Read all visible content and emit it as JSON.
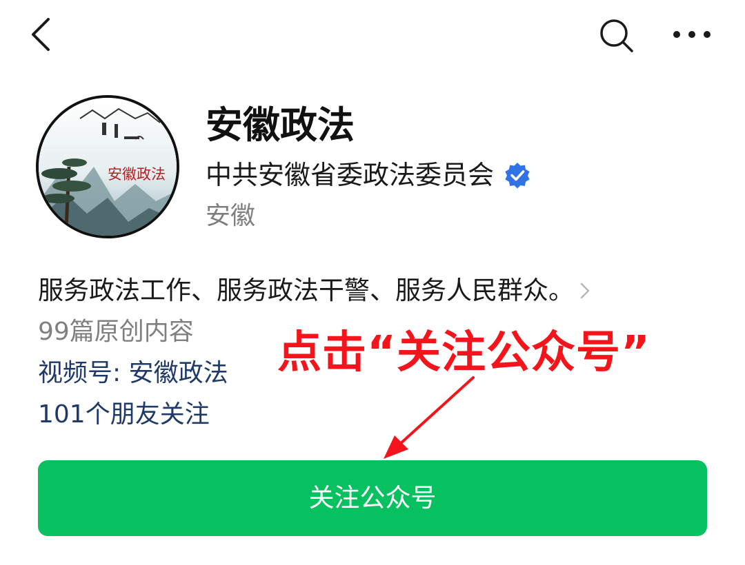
{
  "topbar": {
    "back_icon": "chevron-left-icon",
    "search_icon": "search-icon",
    "more_icon": "more-horizontal-icon"
  },
  "profile": {
    "avatar_text": "安徽政法",
    "name": "安徽政法",
    "organization": "中共安徽省委政法委员会",
    "verified_icon": "verified-badge-icon",
    "verified_color": "#2f73e6",
    "region": "安徽"
  },
  "details": {
    "description": "服务政法工作、服务政法干警、服务人民群众。",
    "original_content": "99篇原创内容",
    "channels": "视频号: 安徽政法",
    "friends_following": "101个朋友关注"
  },
  "annotation": {
    "text": "点击“关注公众号”",
    "color": "#f3151b"
  },
  "follow_button": {
    "label": "关注公众号",
    "color": "#07c160"
  }
}
